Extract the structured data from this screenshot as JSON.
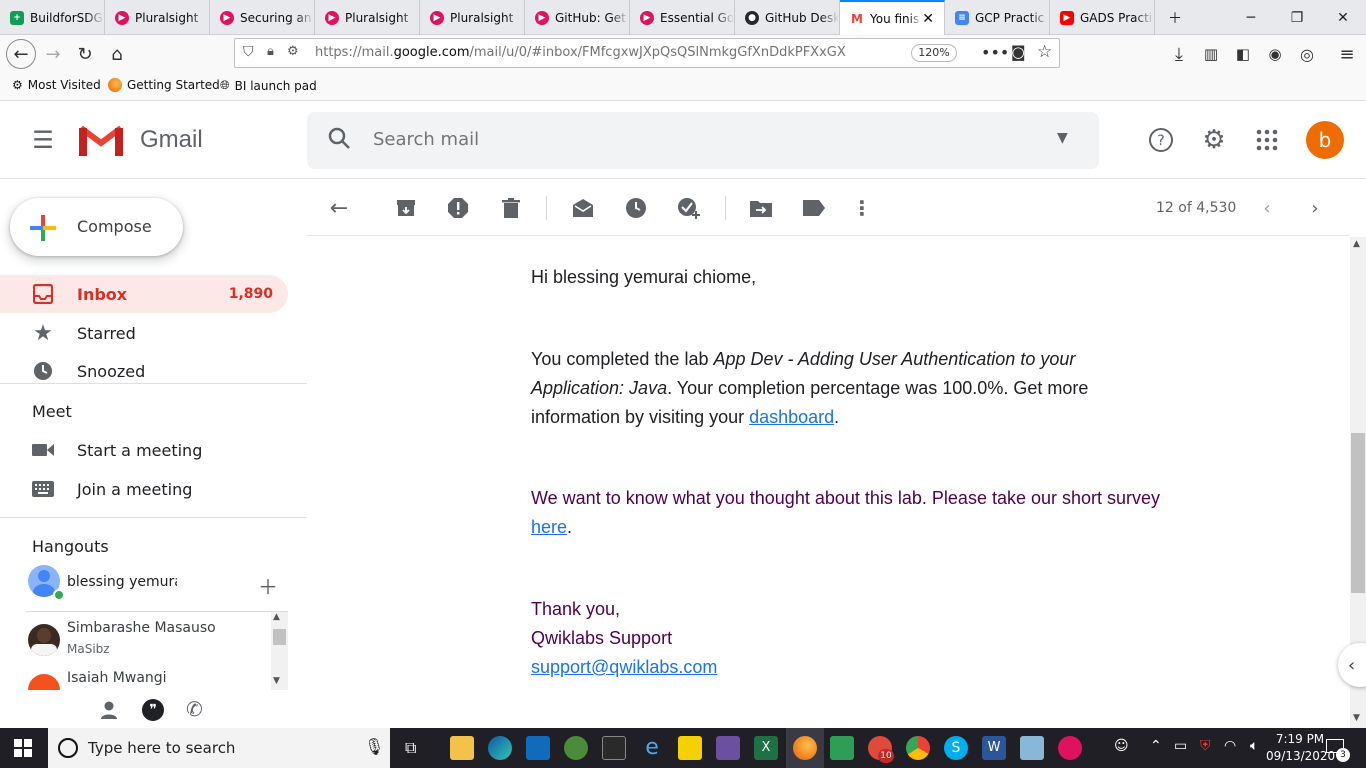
{
  "browser": {
    "tabs": [
      {
        "label": "BuildforSDG",
        "color": "#0f9d58"
      },
      {
        "label": "Pluralsight",
        "color": "#e0115f"
      },
      {
        "label": "Securing an",
        "color": "#e0115f"
      },
      {
        "label": "Pluralsight",
        "color": "#e0115f"
      },
      {
        "label": "Pluralsight",
        "color": "#e0115f"
      },
      {
        "label": "GitHub: Get",
        "color": "#e0115f"
      },
      {
        "label": "Essential Go",
        "color": "#e0115f"
      },
      {
        "label": "GitHub Desk",
        "color": "#24292e"
      },
      {
        "label": "You finis",
        "color": "#ea4335",
        "active": true
      },
      {
        "label": "GCP Practic",
        "color": "#4285f4"
      },
      {
        "label": "GADS Practi",
        "color": "#ff0000"
      }
    ],
    "url_prefix": "https://mail.",
    "url_domain": "google.com",
    "url_suffix": "/mail/u/0/#inbox/FMfcgxwJXpQsQSlNmkgGfXnDdkPFXxGX",
    "zoom": "120%",
    "bookmarks": [
      "Most Visited",
      "Getting Started",
      "BI launch pad"
    ]
  },
  "gmail": {
    "logo_text": "Gmail",
    "search_placeholder": "Search mail",
    "avatar_letter": "b",
    "compose_label": "Compose",
    "nav": [
      {
        "label": "Inbox",
        "count": "1,890"
      },
      {
        "label": "Starred",
        "count": ""
      },
      {
        "label": "Snoozed",
        "count": ""
      }
    ],
    "meet_title": "Meet",
    "meet_items": [
      "Start a meeting",
      "Join a meeting"
    ],
    "hangouts_title": "Hangouts",
    "hangouts_user": "blessing yemurai",
    "contacts": [
      {
        "name": "Simbarashe Masauso",
        "status": "MaSibz"
      },
      {
        "name": "Isaiah Mwangi",
        "status": ""
      }
    ],
    "pager": "12 of 4,530"
  },
  "email": {
    "greeting": "Hi blessing yemurai chiome,",
    "p1_a": "You completed the lab ",
    "p1_lab": "App Dev - Adding User Authentication to your Application: Java",
    "p1_b": ". Your completion percentage was 100.0%. Get more information by visiting your ",
    "p1_link": "dashboard",
    "p1_c": ".",
    "p2_a": "We want to know what you thought about this lab. Please take our short survey ",
    "p2_link": "here",
    "p2_b": ".",
    "sign1": "Thank you,",
    "sign2": "Qwiklabs Support",
    "sign_email": "support@qwiklabs.com"
  },
  "taskbar": {
    "search_placeholder": "Type here to search",
    "time": "7:19 PM",
    "date": "09/13/2020",
    "notifications": "3",
    "app_badge": "10"
  }
}
